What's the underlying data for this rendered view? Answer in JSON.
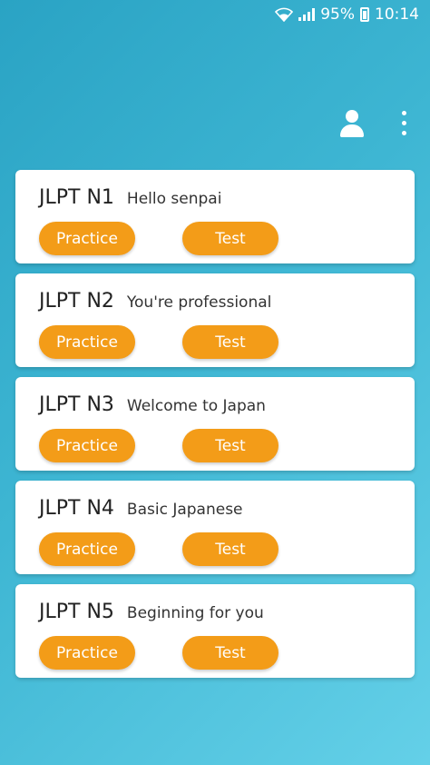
{
  "status_bar": {
    "battery": "95%",
    "time": "10:14",
    "icons": [
      "wifi-icon",
      "signal-icon",
      "battery-charging-icon"
    ]
  },
  "toolbar": {
    "icons": [
      "user-icon",
      "more-vert-icon"
    ]
  },
  "levels": [
    {
      "title": "JLPT N1",
      "subtitle": "Hello senpai",
      "practice_label": "Practice",
      "test_label": "Test"
    },
    {
      "title": "JLPT N2",
      "subtitle": "You're professional",
      "practice_label": "Practice",
      "test_label": "Test"
    },
    {
      "title": "JLPT N3",
      "subtitle": "Welcome to Japan",
      "practice_label": "Practice",
      "test_label": "Test"
    },
    {
      "title": "JLPT N4",
      "subtitle": "Basic Japanese",
      "practice_label": "Practice",
      "test_label": "Test"
    },
    {
      "title": "JLPT N5",
      "subtitle": "Beginning for you",
      "practice_label": "Practice",
      "test_label": "Test"
    }
  ],
  "colors": {
    "accent": "#f39c18",
    "background_start": "#2aa3c4",
    "background_end": "#64d0e8"
  }
}
